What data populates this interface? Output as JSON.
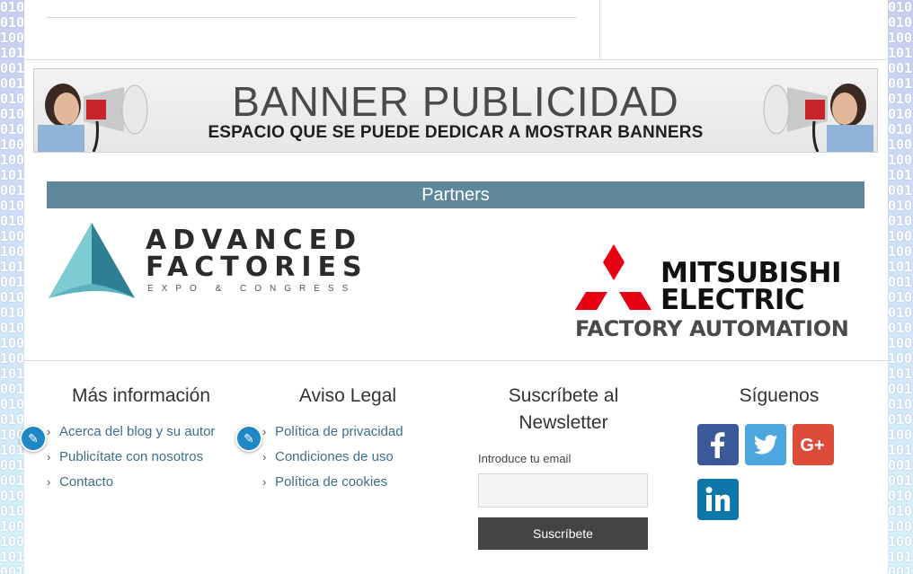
{
  "banner": {
    "title": "BANNER PUBLICIDAD",
    "subtitle": "ESPACIO QUE SE PUEDE DEDICAR A MOSTRAR BANNERS"
  },
  "partners": {
    "heading": "Partners",
    "advanced_factories": {
      "line1": "ADVANCED",
      "line2": "FACTORIES",
      "line3": "EXPO & CONGRESS"
    },
    "mitsubishi": {
      "line1": "MITSUBISHI",
      "line2": "ELECTRIC",
      "line3": "FACTORY AUTOMATION"
    }
  },
  "footer": {
    "mas_info": {
      "title": "Más información",
      "links": [
        "Acerca del blog y su autor",
        "Publicítate con nosotros",
        "Contacto"
      ]
    },
    "aviso_legal": {
      "title": "Aviso Legal",
      "links": [
        "Política de privacidad",
        "Condiciones de uso",
        "Política de cookies"
      ]
    },
    "newsletter": {
      "title_line1": "Suscríbete al",
      "title_line2": "Newsletter",
      "email_label": "Introduce tu email",
      "email_value": "",
      "button": "Suscríbete"
    },
    "siguenos": {
      "title": "Síguenos",
      "networks": [
        "facebook-icon",
        "twitter-icon",
        "google-plus-icon",
        "linkedin-icon"
      ]
    }
  },
  "colors": {
    "partners_bar": "#5e879b",
    "link": "#3d6f89",
    "facebook": "#3b5998",
    "twitter": "#4da7de",
    "google_plus": "#dd4b39",
    "linkedin": "#0e76a8",
    "subscribe_button": "#444444"
  }
}
